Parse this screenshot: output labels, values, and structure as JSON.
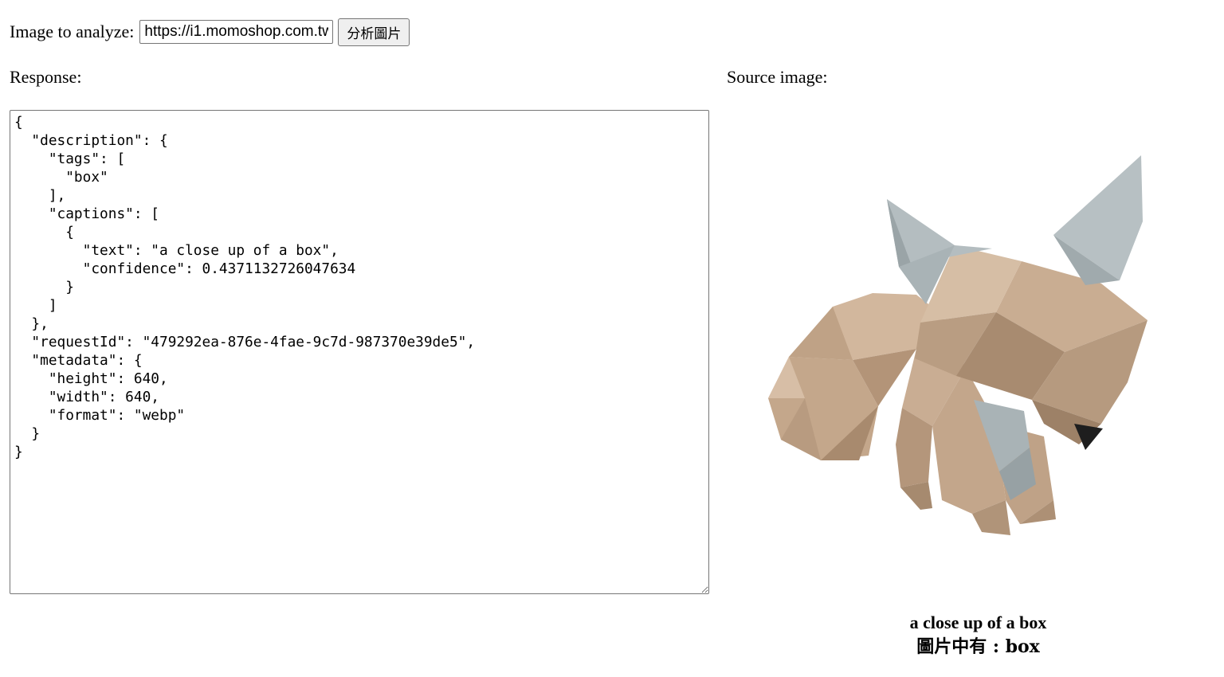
{
  "form": {
    "label": "Image to analyze:",
    "url_value": "https://i1.momoshop.com.tw",
    "button_label": "分析圖片"
  },
  "response": {
    "label": "Response:",
    "json_text": "{\n  \"description\": {\n    \"tags\": [\n      \"box\"\n    ],\n    \"captions\": [\n      {\n        \"text\": \"a close up of a box\",\n        \"confidence\": 0.4371132726047634\n      }\n    ]\n  },\n  \"requestId\": \"479292ea-876e-4fae-9c7d-987370e39de5\",\n  \"metadata\": {\n    \"height\": 640,\n    \"width\": 640,\n    \"format\": \"webp\"\n  }\n}"
  },
  "source": {
    "label": "Source image:",
    "caption": "a close up of a box",
    "tags_line": "圖片中有 : box"
  },
  "colors": {
    "cardboard": "#c8ad93",
    "ear_grey": "#a9b3b6"
  }
}
